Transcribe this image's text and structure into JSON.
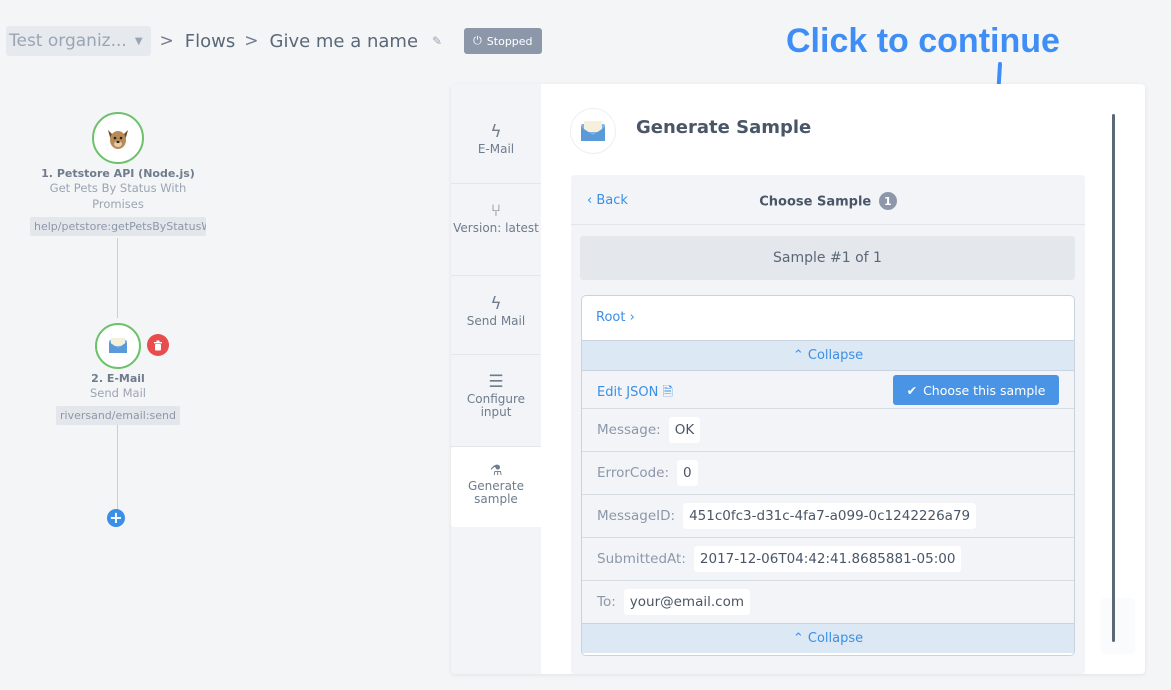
{
  "breadcrumb": {
    "org": "Test organiz...",
    "flows": "Flows",
    "flow_name": "Give me a name",
    "status": "Stopped",
    "separator": ">"
  },
  "annotation": "Click to continue",
  "flow": {
    "nodes": [
      {
        "title": "1. Petstore API (Node.js)",
        "desc": "Get Pets By Status With Promises",
        "tag": "help/petstore:getPetsByStatusW",
        "icon": "dog-icon"
      },
      {
        "title": "2. E-Mail",
        "desc": "Send Mail",
        "tag": "riversand/email:send",
        "icon": "envelope-icon"
      }
    ]
  },
  "steps": [
    {
      "label": "E-Mail",
      "icon": "bolt-icon"
    },
    {
      "label": "Version: latest",
      "icon": "branch-icon"
    },
    {
      "label": "Send Mail",
      "icon": "bolt-icon"
    },
    {
      "label": "Configure input",
      "icon": "menu-icon"
    },
    {
      "label": "Generate sample",
      "icon": "flask-icon"
    }
  ],
  "panel": {
    "title": "Generate Sample",
    "back": "Back",
    "choose_title": "Choose Sample",
    "count": "1",
    "sample_label": "Sample #1 of 1",
    "root": "Root",
    "collapse": "Collapse",
    "edit_json": "Edit JSON",
    "choose_btn": "Choose this sample",
    "fields": [
      {
        "key": "Message:",
        "value": "OK"
      },
      {
        "key": "ErrorCode:",
        "value": "0"
      },
      {
        "key": "MessageID:",
        "value": "451c0fc3-d31c-4fa7-a099-0c1242226a79"
      },
      {
        "key": "SubmittedAt:",
        "value": "2017-12-06T04:42:41.8685881-05:00"
      },
      {
        "key": "To:",
        "value": "your@email.com"
      }
    ]
  },
  "colors": {
    "accent": "#3b8fe6",
    "annotation": "#3f8ef5",
    "ok_ring": "#6cc26a",
    "delete": "#e84c4c"
  }
}
